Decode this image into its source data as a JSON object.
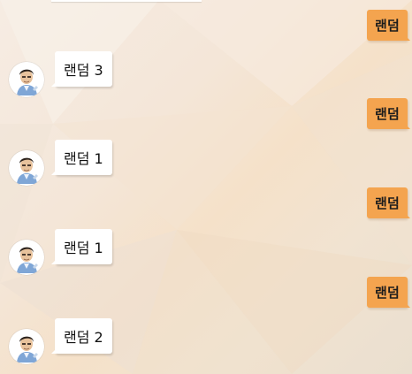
{
  "chat": {
    "sent_messages": [
      {
        "text": "랜덤"
      },
      {
        "text": "랜덤"
      },
      {
        "text": "랜덤"
      },
      {
        "text": "랜덤"
      }
    ],
    "received_messages": [
      {
        "text": "랜덤 3",
        "avatar": "user-avatar-icon"
      },
      {
        "text": "랜덤 1",
        "avatar": "user-avatar-icon"
      },
      {
        "text": "랜덤 1",
        "avatar": "user-avatar-icon"
      },
      {
        "text": "랜덤 2",
        "avatar": "user-avatar-icon"
      }
    ]
  },
  "theme": {
    "sent_bubble_color": "#f4a44f",
    "received_bubble_color": "#ffffff"
  }
}
